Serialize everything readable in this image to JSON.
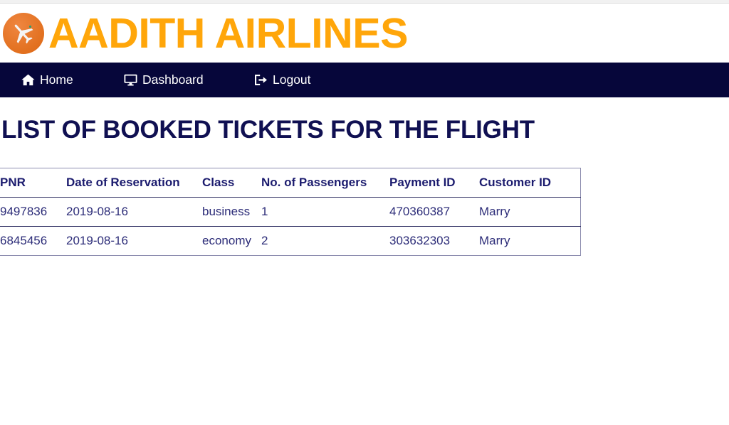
{
  "brand": {
    "logo_icon": "airplane-icon",
    "title": "AADITH AIRLINES",
    "accent_color": "#ffa60a",
    "logo_bg_color": "#e2701f"
  },
  "navbar": {
    "background_color": "#06063a",
    "items": [
      {
        "label": "Home",
        "icon": "home-icon"
      },
      {
        "label": "Dashboard",
        "icon": "desktop-icon"
      },
      {
        "label": "Logout",
        "icon": "sign-out-icon"
      }
    ]
  },
  "page": {
    "title": "LIST OF BOOKED TICKETS FOR THE FLIGHT",
    "title_color": "#101052"
  },
  "table": {
    "headers": [
      "PNR",
      "Date of Reservation",
      "Class",
      "No. of Passengers",
      "Payment ID",
      "Customer ID"
    ],
    "rows": [
      {
        "pnr": "9497836",
        "date_of_reservation": "2019-08-16",
        "class": "business",
        "no_of_passengers": "1",
        "payment_id": "470360387",
        "customer_id": "Marry"
      },
      {
        "pnr": "6845456",
        "date_of_reservation": "2019-08-16",
        "class": "economy",
        "no_of_passengers": "2",
        "payment_id": "303632303",
        "customer_id": "Marry"
      }
    ]
  }
}
